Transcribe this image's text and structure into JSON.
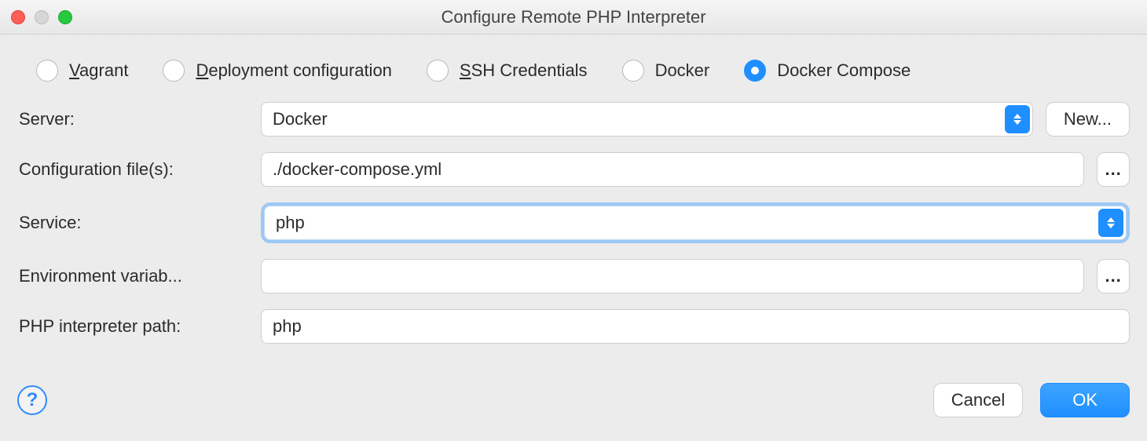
{
  "window": {
    "title": "Configure Remote PHP Interpreter"
  },
  "radios": {
    "vagrant": {
      "prefix": "V",
      "rest": "agrant"
    },
    "deployment": {
      "prefix": "D",
      "rest": "eployment configuration"
    },
    "ssh": {
      "prefix": "S",
      "rest": "SH Credentials"
    },
    "docker": {
      "label": "Docker"
    },
    "docker_compose": {
      "label": "Docker Compose"
    },
    "selected": "docker_compose"
  },
  "form": {
    "server": {
      "label": "Server:",
      "value": "Docker",
      "new_button": "New..."
    },
    "config_files": {
      "label": "Configuration file(s):",
      "value": "./docker-compose.yml",
      "browse": "..."
    },
    "service": {
      "label": "Service:",
      "value": "php"
    },
    "env_vars": {
      "label": "Environment variab...",
      "value": "",
      "browse": "..."
    },
    "php_path": {
      "label": "PHP interpreter path:",
      "value": "php"
    }
  },
  "footer": {
    "help": "?",
    "cancel": "Cancel",
    "ok": "OK"
  }
}
